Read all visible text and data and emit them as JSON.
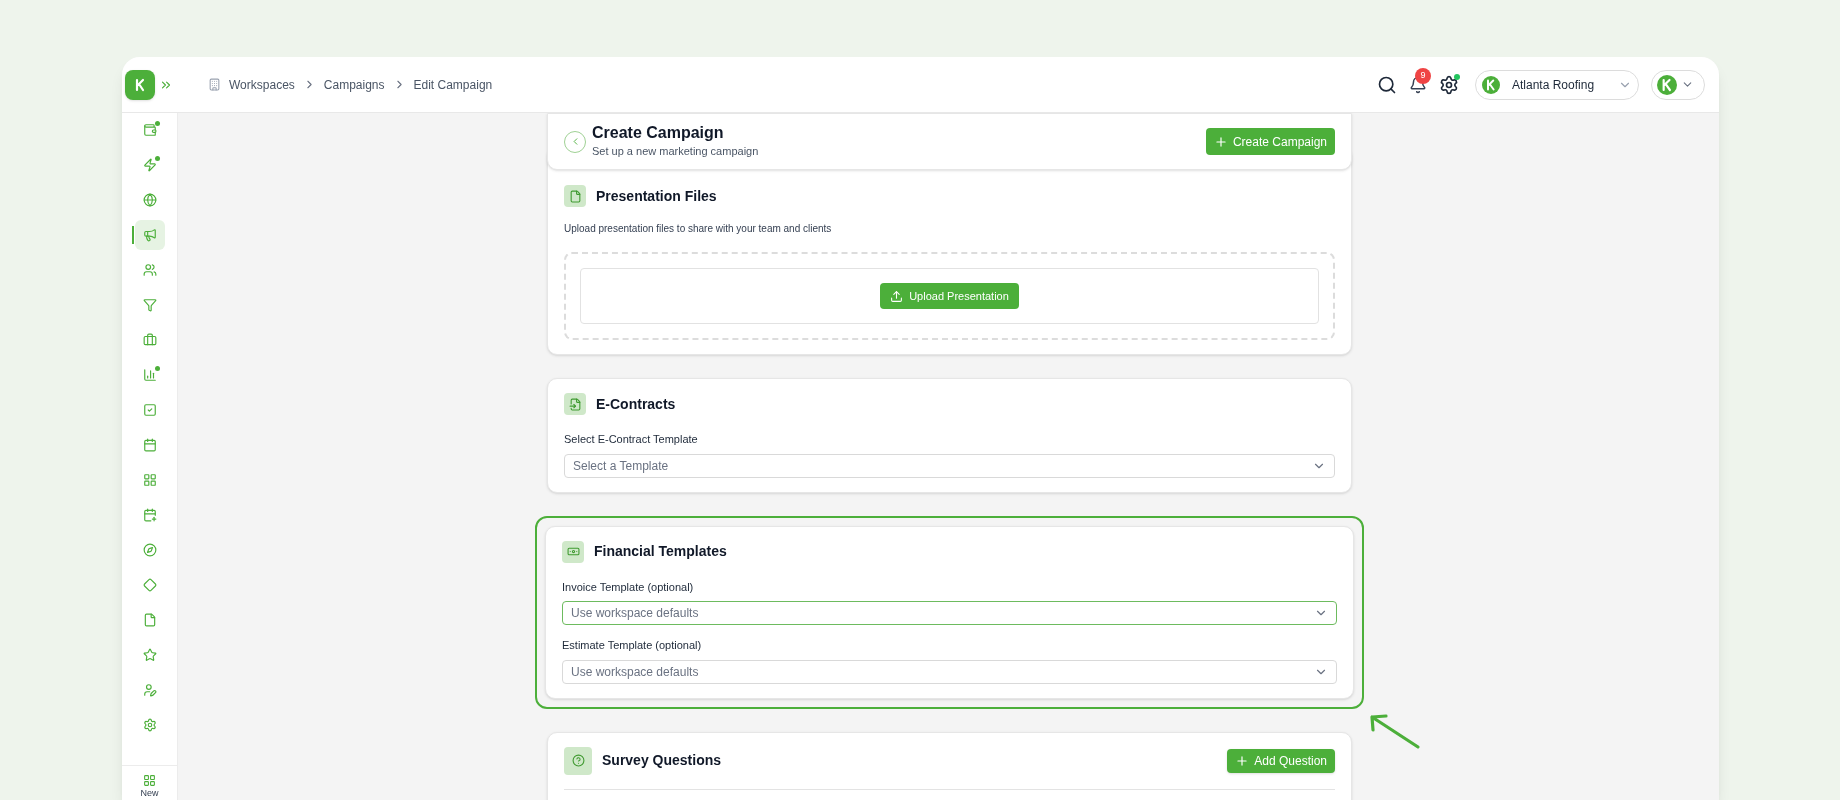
{
  "breadcrumb": [
    {
      "label": "Workspaces"
    },
    {
      "label": "Campaigns"
    },
    {
      "label": "Edit Campaign"
    }
  ],
  "topbar": {
    "notification_count": "9",
    "settings_dot": true,
    "account": {
      "name": "Atlanta Roofing"
    }
  },
  "sidebar": {
    "items": [
      {
        "kind": "wallet",
        "selected": false,
        "dot": true
      },
      {
        "kind": "bolt",
        "selected": false,
        "dot": true
      },
      {
        "kind": "globe",
        "selected": false,
        "dot": false
      },
      {
        "kind": "megaphone",
        "selected": true,
        "dot": false
      },
      {
        "kind": "users",
        "selected": false,
        "dot": false
      },
      {
        "kind": "filter",
        "selected": false,
        "dot": false
      },
      {
        "kind": "briefcase",
        "selected": false,
        "dot": false
      },
      {
        "kind": "chart",
        "selected": false,
        "dot": true
      },
      {
        "kind": "task",
        "selected": false,
        "dot": false
      },
      {
        "kind": "calendar",
        "selected": false,
        "dot": false
      },
      {
        "kind": "grid",
        "selected": false,
        "dot": false
      },
      {
        "kind": "calendar-plus",
        "selected": false,
        "dot": false
      },
      {
        "kind": "compass",
        "selected": false,
        "dot": false
      },
      {
        "kind": "route",
        "selected": false,
        "dot": false
      },
      {
        "kind": "file",
        "selected": false,
        "dot": false
      },
      {
        "kind": "star",
        "selected": false,
        "dot": false
      },
      {
        "kind": "user-pen",
        "selected": false,
        "dot": false
      },
      {
        "kind": "settings",
        "selected": false,
        "dot": false
      }
    ],
    "new_label": "New"
  },
  "header": {
    "title": "Create Campaign",
    "subtitle": "Set up a new marketing campaign",
    "button": "Create Campaign"
  },
  "sections": [
    {
      "kind": "upload",
      "title": "Presentation Files",
      "highlighted": false,
      "description": "Upload presentation files to share with your team and clients",
      "button": "Upload Presentation"
    },
    {
      "kind": "contract",
      "title": "E-Contracts",
      "highlighted": false,
      "fields": [
        {
          "label": "Select E-Contract Template",
          "placeholder": "Select a Template",
          "focused": false
        }
      ]
    },
    {
      "kind": "financial",
      "title": "Financial Templates",
      "highlighted": true,
      "fields": [
        {
          "label": "Invoice Template (optional)",
          "placeholder": "Use workspace defaults",
          "focused": true
        },
        {
          "label": "Estimate Template (optional)",
          "placeholder": "Use workspace defaults",
          "focused": false
        }
      ]
    },
    {
      "kind": "survey",
      "title": "Survey Questions",
      "highlighted": false,
      "button": "Add Question"
    }
  ]
}
